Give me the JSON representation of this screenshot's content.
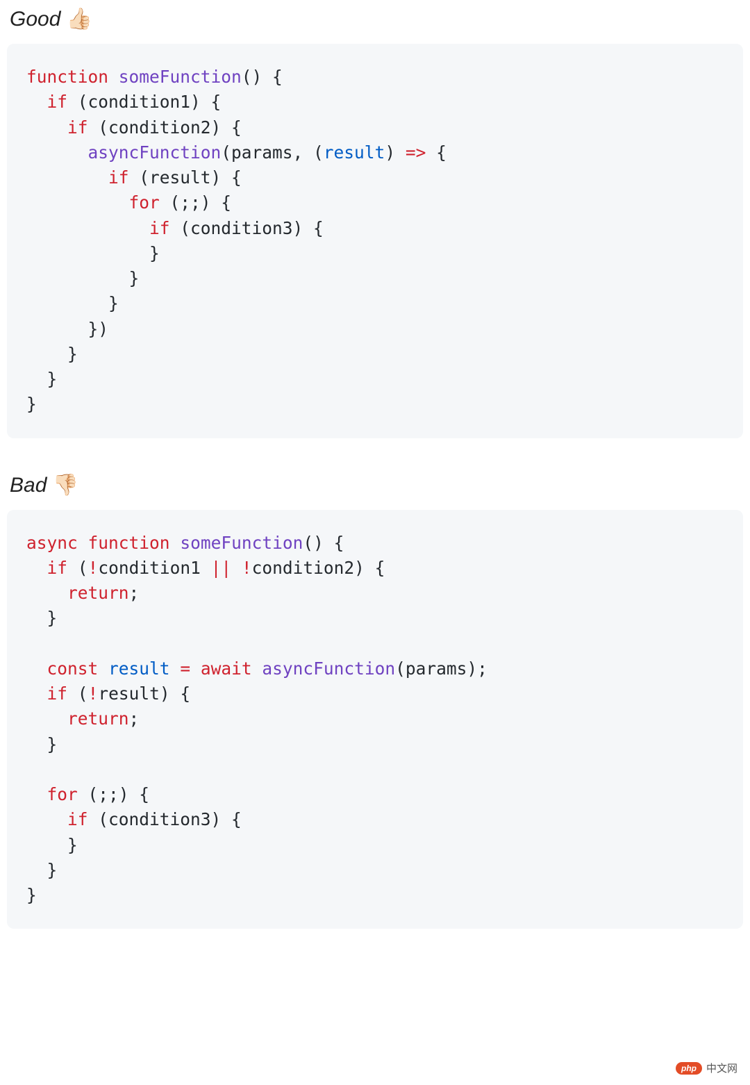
{
  "sections": {
    "good": {
      "label": "Good",
      "emoji": "👍🏻"
    },
    "bad": {
      "label": "Bad",
      "emoji": "👎🏻"
    }
  },
  "code": {
    "good": {
      "tokens": [
        [
          "kw",
          "function"
        ],
        [
          "pn",
          " "
        ],
        [
          "fn",
          "someFunction"
        ],
        [
          "pn",
          "() {"
        ],
        [
          "nl",
          ""
        ],
        [
          "pn",
          "  "
        ],
        [
          "kw",
          "if"
        ],
        [
          "pn",
          " (condition1) {"
        ],
        [
          "nl",
          ""
        ],
        [
          "pn",
          "    "
        ],
        [
          "kw",
          "if"
        ],
        [
          "pn",
          " (condition2) {"
        ],
        [
          "nl",
          ""
        ],
        [
          "pn",
          "      "
        ],
        [
          "fn",
          "asyncFunction"
        ],
        [
          "pn",
          "(params, ("
        ],
        [
          "vr",
          "result"
        ],
        [
          "pn",
          ") "
        ],
        [
          "op",
          "=>"
        ],
        [
          "pn",
          " {"
        ],
        [
          "nl",
          ""
        ],
        [
          "pn",
          "        "
        ],
        [
          "kw",
          "if"
        ],
        [
          "pn",
          " (result) {"
        ],
        [
          "nl",
          ""
        ],
        [
          "pn",
          "          "
        ],
        [
          "kw",
          "for"
        ],
        [
          "pn",
          " (;;) {"
        ],
        [
          "nl",
          ""
        ],
        [
          "pn",
          "            "
        ],
        [
          "kw",
          "if"
        ],
        [
          "pn",
          " (condition3) {"
        ],
        [
          "nl",
          ""
        ],
        [
          "pn",
          "            }"
        ],
        [
          "nl",
          ""
        ],
        [
          "pn",
          "          }"
        ],
        [
          "nl",
          ""
        ],
        [
          "pn",
          "        }"
        ],
        [
          "nl",
          ""
        ],
        [
          "pn",
          "      })"
        ],
        [
          "nl",
          ""
        ],
        [
          "pn",
          "    }"
        ],
        [
          "nl",
          ""
        ],
        [
          "pn",
          "  }"
        ],
        [
          "nl",
          ""
        ],
        [
          "pn",
          "}"
        ]
      ]
    },
    "bad": {
      "tokens": [
        [
          "kw",
          "async"
        ],
        [
          "pn",
          " "
        ],
        [
          "kw",
          "function"
        ],
        [
          "pn",
          " "
        ],
        [
          "fn",
          "someFunction"
        ],
        [
          "pn",
          "() {"
        ],
        [
          "nl",
          ""
        ],
        [
          "pn",
          "  "
        ],
        [
          "kw",
          "if"
        ],
        [
          "pn",
          " ("
        ],
        [
          "op",
          "!"
        ],
        [
          "pn",
          "condition1 "
        ],
        [
          "op",
          "||"
        ],
        [
          "pn",
          " "
        ],
        [
          "op",
          "!"
        ],
        [
          "pn",
          "condition2) {"
        ],
        [
          "nl",
          ""
        ],
        [
          "pn",
          "    "
        ],
        [
          "kw",
          "return"
        ],
        [
          "pn",
          ";"
        ],
        [
          "nl",
          ""
        ],
        [
          "pn",
          "  }"
        ],
        [
          "nl",
          ""
        ],
        [
          "nl",
          ""
        ],
        [
          "pn",
          "  "
        ],
        [
          "kw",
          "const"
        ],
        [
          "pn",
          " "
        ],
        [
          "vr",
          "result"
        ],
        [
          "pn",
          " "
        ],
        [
          "op",
          "="
        ],
        [
          "pn",
          " "
        ],
        [
          "kw",
          "await"
        ],
        [
          "pn",
          " "
        ],
        [
          "fn",
          "asyncFunction"
        ],
        [
          "pn",
          "(params);"
        ],
        [
          "nl",
          ""
        ],
        [
          "pn",
          "  "
        ],
        [
          "kw",
          "if"
        ],
        [
          "pn",
          " ("
        ],
        [
          "op",
          "!"
        ],
        [
          "pn",
          "result) {"
        ],
        [
          "nl",
          ""
        ],
        [
          "pn",
          "    "
        ],
        [
          "kw",
          "return"
        ],
        [
          "pn",
          ";"
        ],
        [
          "nl",
          ""
        ],
        [
          "pn",
          "  }"
        ],
        [
          "nl",
          ""
        ],
        [
          "nl",
          ""
        ],
        [
          "pn",
          "  "
        ],
        [
          "kw",
          "for"
        ],
        [
          "pn",
          " (;;) {"
        ],
        [
          "nl",
          ""
        ],
        [
          "pn",
          "    "
        ],
        [
          "kw",
          "if"
        ],
        [
          "pn",
          " (condition3) {"
        ],
        [
          "nl",
          ""
        ],
        [
          "pn",
          "    }"
        ],
        [
          "nl",
          ""
        ],
        [
          "pn",
          "  }"
        ],
        [
          "nl",
          ""
        ],
        [
          "pn",
          "}"
        ]
      ]
    }
  },
  "watermark": {
    "badge": "php",
    "text": "中文网"
  }
}
